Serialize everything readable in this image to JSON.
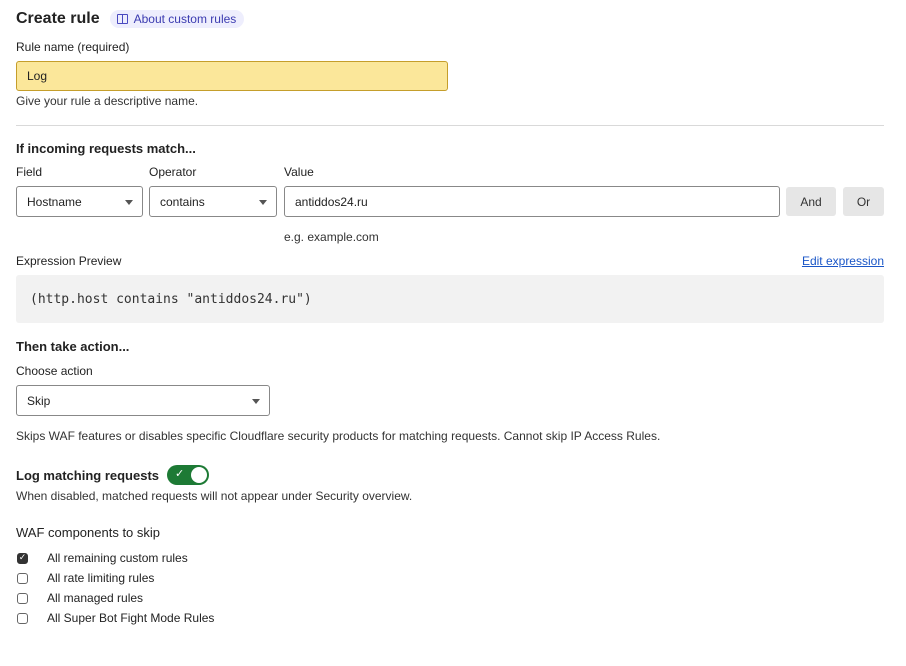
{
  "header": {
    "title": "Create rule",
    "about_link": "About custom rules",
    "about_icon": "book-icon"
  },
  "rule_name": {
    "label": "Rule name (required)",
    "value": "Log",
    "help": "Give your rule a descriptive name."
  },
  "match": {
    "title": "If incoming requests match...",
    "field_label": "Field",
    "operator_label": "Operator",
    "value_label": "Value",
    "field_value": "Hostname",
    "operator_value": "contains",
    "value_value": "antiddos24.ru",
    "value_example": "e.g. example.com",
    "and_label": "And",
    "or_label": "Or"
  },
  "expression": {
    "label": "Expression Preview",
    "edit_link": "Edit expression",
    "text": "(http.host contains \"antiddos24.ru\")"
  },
  "action": {
    "title": "Then take action...",
    "choose_label": "Choose action",
    "selected": "Skip",
    "description": "Skips WAF features or disables specific Cloudflare security products for matching requests. Cannot skip IP Access Rules."
  },
  "logging": {
    "title": "Log matching requests",
    "enabled": true,
    "toggle_color": "#1d7a35",
    "description": "When disabled, matched requests will not appear under Security overview."
  },
  "waf": {
    "title": "WAF components to skip",
    "items": [
      {
        "label": "All remaining custom rules",
        "checked": true
      },
      {
        "label": "All rate limiting rules",
        "checked": false
      },
      {
        "label": "All managed rules",
        "checked": false
      },
      {
        "label": "All Super Bot Fight Mode Rules",
        "checked": false
      }
    ]
  }
}
